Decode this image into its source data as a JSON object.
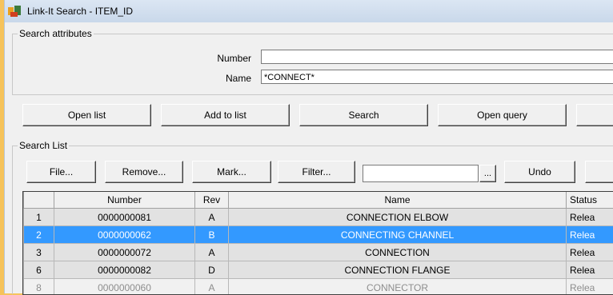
{
  "window": {
    "title": "Link-It Search - ITEM_ID"
  },
  "search_attributes": {
    "legend": "Search attributes",
    "number_label": "Number",
    "number_value": "",
    "name_label": "Name",
    "name_value": "*CONNECT*"
  },
  "actions": {
    "open_list": "Open list",
    "add_to_list": "Add to list",
    "search": "Search",
    "open_query": "Open query"
  },
  "search_list": {
    "legend": "Search List",
    "file": "File...",
    "remove": "Remove...",
    "mark": "Mark...",
    "filter": "Filter...",
    "filter_value": "",
    "browse": "...",
    "undo": "Undo",
    "columns": [
      "",
      "Number",
      "Rev",
      "Name",
      "Status"
    ],
    "rows": [
      {
        "idx": "1",
        "number": "0000000081",
        "rev": "A",
        "name": "CONNECTION ELBOW",
        "status": "Relea"
      },
      {
        "idx": "2",
        "number": "0000000062",
        "rev": "B",
        "name": "CONNECTING CHANNEL",
        "status": "Relea"
      },
      {
        "idx": "3",
        "number": "0000000072",
        "rev": "A",
        "name": "CONNECTION",
        "status": "Relea"
      },
      {
        "idx": "6",
        "number": "0000000082",
        "rev": "D",
        "name": "CONNECTION FLANGE",
        "status": "Relea"
      },
      {
        "idx": "8",
        "number": "0000000060",
        "rev": "A",
        "name": "CONNECTOR",
        "status": "Relea"
      }
    ]
  }
}
